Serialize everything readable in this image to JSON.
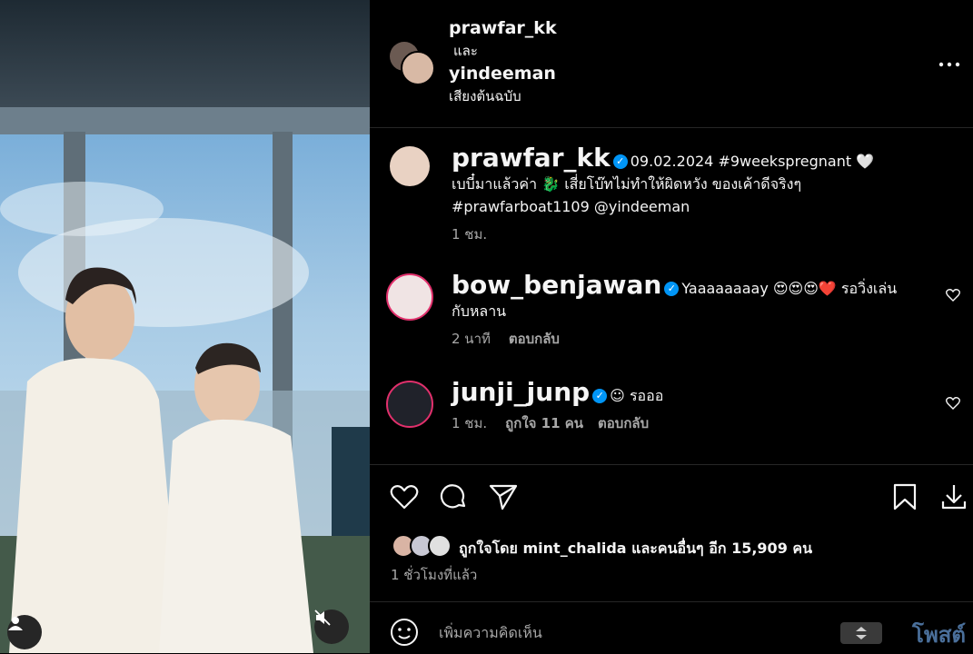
{
  "header": {
    "user1": "prawfar_kk",
    "and_text": "และ",
    "user2": "yindeeman",
    "audio": "เสียงต้นฉบับ",
    "more_icon": "more-horizontal-icon"
  },
  "caption": {
    "username": "prawfar_kk",
    "text_line1": "09.02.2024 #9weekspregnant 🤍",
    "text_line2": "เบบี๋มาแล้วค่า 🐉 เสี่ยโบ๊ทไม่ทำให้ผิดหวัง ของเค้าดีจริงๆ",
    "text_line3": "#prawfarboat1109 @yindeeman",
    "time": "1 ชม."
  },
  "comments": [
    {
      "username": "bow_benjawan",
      "text_line1": "Yaaaaaaaay 😍😍😍❤️ รอวิ่งเล่น",
      "text_line2": "กับหลาน",
      "time": "2 นาที",
      "reply": "ตอบกลับ"
    },
    {
      "username": "junji_junp",
      "text_line1": "☺ รอออ",
      "time": "1 ชม.",
      "likes": "ถูกใจ 11 คน",
      "reply": "ตอบกลับ"
    }
  ],
  "actions": {
    "like_icon": "heart-icon",
    "comment_icon": "comment-icon",
    "share_icon": "send-icon",
    "save_icon": "bookmark-icon",
    "download_icon": "download-icon"
  },
  "likes": {
    "text": "ถูกใจโดย mint_chalida และคนอื่นๆ อีก 15,909 คน"
  },
  "posted_time": "1 ชั่วโมงที่แล้ว",
  "composer": {
    "placeholder": "เพิ่มความคิดเห็น",
    "post_label": "โพสต์"
  },
  "colors": {
    "verified": "#0095f6",
    "secondary_text": "#a8a8a8",
    "post_button": "#4a6f9a"
  }
}
